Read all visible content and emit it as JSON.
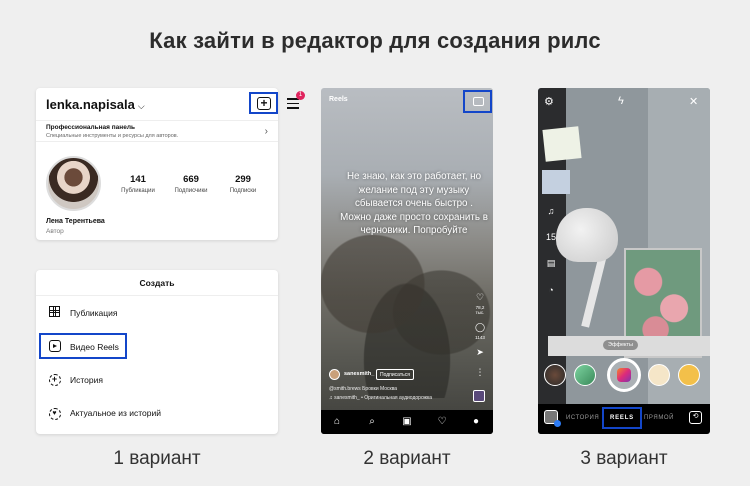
{
  "title": "Как зайти в редактор для создания рилс",
  "captions": [
    "1 вариант",
    "2 вариант",
    "3 вариант"
  ],
  "accent_color": "#1346c9",
  "variant1": {
    "profile": {
      "username": "lenka.napisala",
      "notification_count": "1",
      "pro_panel_title": "Профессиональная панель",
      "pro_panel_subtitle": "Специальные инструменты и ресурсы для авторов.",
      "stats": [
        {
          "value": "141",
          "label": "Публикации"
        },
        {
          "value": "669",
          "label": "Подписчики"
        },
        {
          "value": "299",
          "label": "Подписки"
        }
      ],
      "name": "Лена Терентьева",
      "role": "Автор"
    },
    "create_menu": {
      "title": "Создать",
      "items": [
        {
          "label": "Публикация",
          "icon": "grid-icon"
        },
        {
          "label": "Видео Reels",
          "icon": "reels-icon"
        },
        {
          "label": "История",
          "icon": "story-plus-icon"
        },
        {
          "label": "Актуальное из историй",
          "icon": "highlight-heart-icon"
        }
      ]
    }
  },
  "variant2": {
    "header": "Reels",
    "overlay_text": "Не знаю, как это работает, но желание под эту музыку сбывается очень быстро . Можно даже просто сохранить в черновики. Попробуйте",
    "like_count": "78,2 тыс.",
    "comment_count": "1143",
    "author": "sanesmith_",
    "subscribe": "Подписаться",
    "description": "@smith.brews  Бровки Москва",
    "music": "♫ sanesmith_ • Оригинальная аудиодорожка"
  },
  "variant3": {
    "effects_label": "Эффекты",
    "modes": [
      "ИСТОРИЯ",
      "REELS",
      "ПРЯМОЙ"
    ],
    "timer_label": "15"
  }
}
